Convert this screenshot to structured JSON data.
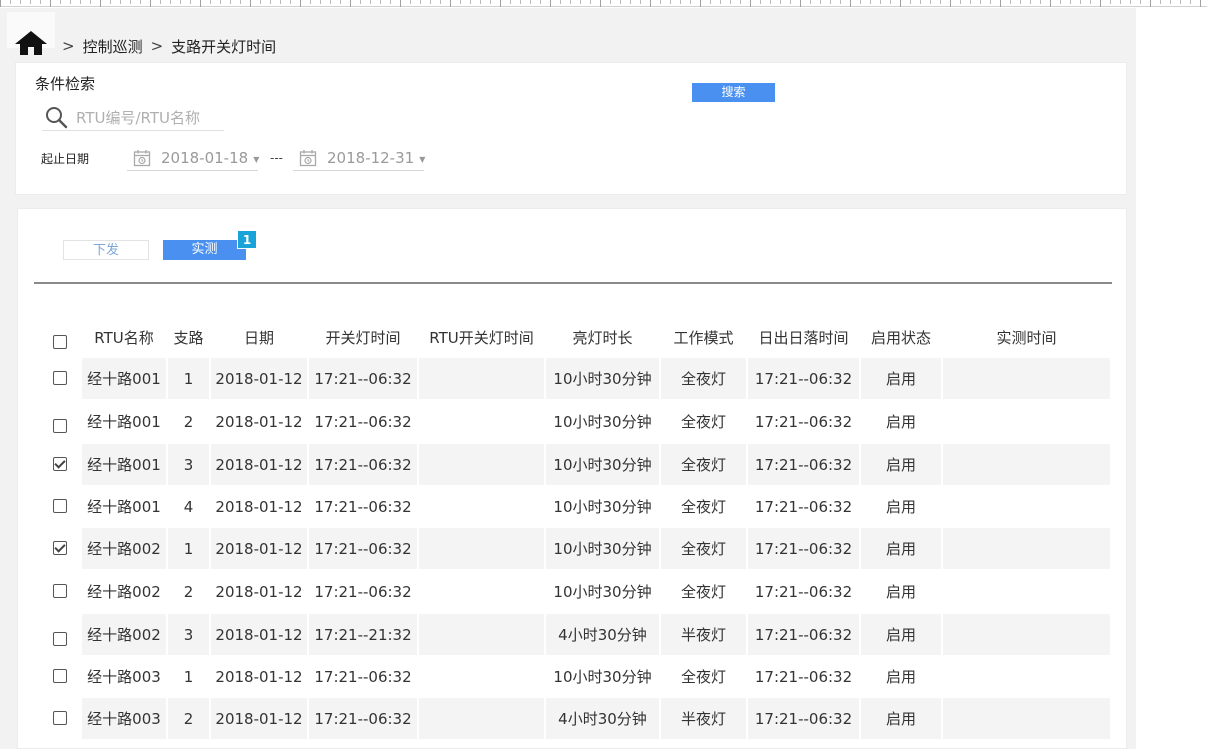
{
  "breadcrumb": {
    "sep": ">",
    "items": [
      "控制巡测",
      "支路开关灯时间"
    ]
  },
  "search": {
    "title": "条件检索",
    "placeholder": "RTU编号/RTU名称",
    "button": "搜索",
    "date_label": "起止日期",
    "start_date": "2018-01-18",
    "end_date": "2018-12-31",
    "date_sep": "---"
  },
  "tabs": {
    "issue": "下发",
    "measure": "实测",
    "badge": "1"
  },
  "table": {
    "headers": [
      "RTU名称",
      "支路",
      "日期",
      "开关灯时间",
      "RTU开关灯时间",
      "亮灯时长",
      "工作模式",
      "日出日落时间",
      "启用状态",
      "实测时间"
    ],
    "rows": [
      {
        "checked": false,
        "name": "经十路001",
        "branch": "1",
        "date": "2018-01-12",
        "switch_time": "17:21--06:32",
        "rtu_time": "",
        "duration": "10小时30分钟",
        "mode": "全夜灯",
        "sun": "17:21--06:32",
        "status": "启用",
        "measure_time": ""
      },
      {
        "checked": false,
        "name": "经十路001",
        "branch": "2",
        "date": "2018-01-12",
        "switch_time": "17:21--06:32",
        "rtu_time": "",
        "duration": "10小时30分钟",
        "mode": "全夜灯",
        "sun": "17:21--06:32",
        "status": "启用",
        "measure_time": ""
      },
      {
        "checked": true,
        "name": "经十路001",
        "branch": "3",
        "date": "2018-01-12",
        "switch_time": "17:21--06:32",
        "rtu_time": "",
        "duration": "10小时30分钟",
        "mode": "全夜灯",
        "sun": "17:21--06:32",
        "status": "启用",
        "measure_time": ""
      },
      {
        "checked": false,
        "name": "经十路001",
        "branch": "4",
        "date": "2018-01-12",
        "switch_time": "17:21--06:32",
        "rtu_time": "",
        "duration": "10小时30分钟",
        "mode": "全夜灯",
        "sun": "17:21--06:32",
        "status": "启用",
        "measure_time": ""
      },
      {
        "checked": true,
        "name": "经十路002",
        "branch": "1",
        "date": "2018-01-12",
        "switch_time": "17:21--06:32",
        "rtu_time": "",
        "duration": "10小时30分钟",
        "mode": "全夜灯",
        "sun": "17:21--06:32",
        "status": "启用",
        "measure_time": ""
      },
      {
        "checked": false,
        "name": "经十路002",
        "branch": "2",
        "date": "2018-01-12",
        "switch_time": "17:21--06:32",
        "rtu_time": "",
        "duration": "10小时30分钟",
        "mode": "全夜灯",
        "sun": "17:21--06:32",
        "status": "启用",
        "measure_time": ""
      },
      {
        "checked": false,
        "name": "经十路002",
        "branch": "3",
        "date": "2018-01-12",
        "switch_time": "17:21--21:32",
        "rtu_time": "",
        "duration": "4小时30分钟",
        "mode": "半夜灯",
        "sun": "17:21--06:32",
        "status": "启用",
        "measure_time": ""
      },
      {
        "checked": false,
        "name": "经十路003",
        "branch": "1",
        "date": "2018-01-12",
        "switch_time": "17:21--06:32",
        "rtu_time": "",
        "duration": "10小时30分钟",
        "mode": "全夜灯",
        "sun": "17:21--06:32",
        "status": "启用",
        "measure_time": ""
      },
      {
        "checked": false,
        "name": "经十路003",
        "branch": "2",
        "date": "2018-01-12",
        "switch_time": "17:21--06:32",
        "rtu_time": "",
        "duration": "4小时30分钟",
        "mode": "半夜灯",
        "sun": "17:21--06:32",
        "status": "启用",
        "measure_time": ""
      }
    ]
  },
  "colors": {
    "primary": "#4a90f0",
    "badge": "#1aa3d8",
    "row_alt": "#f4f4f4"
  },
  "icons": [
    "home-icon",
    "search-icon",
    "calendar-icon",
    "checkbox-icon"
  ]
}
